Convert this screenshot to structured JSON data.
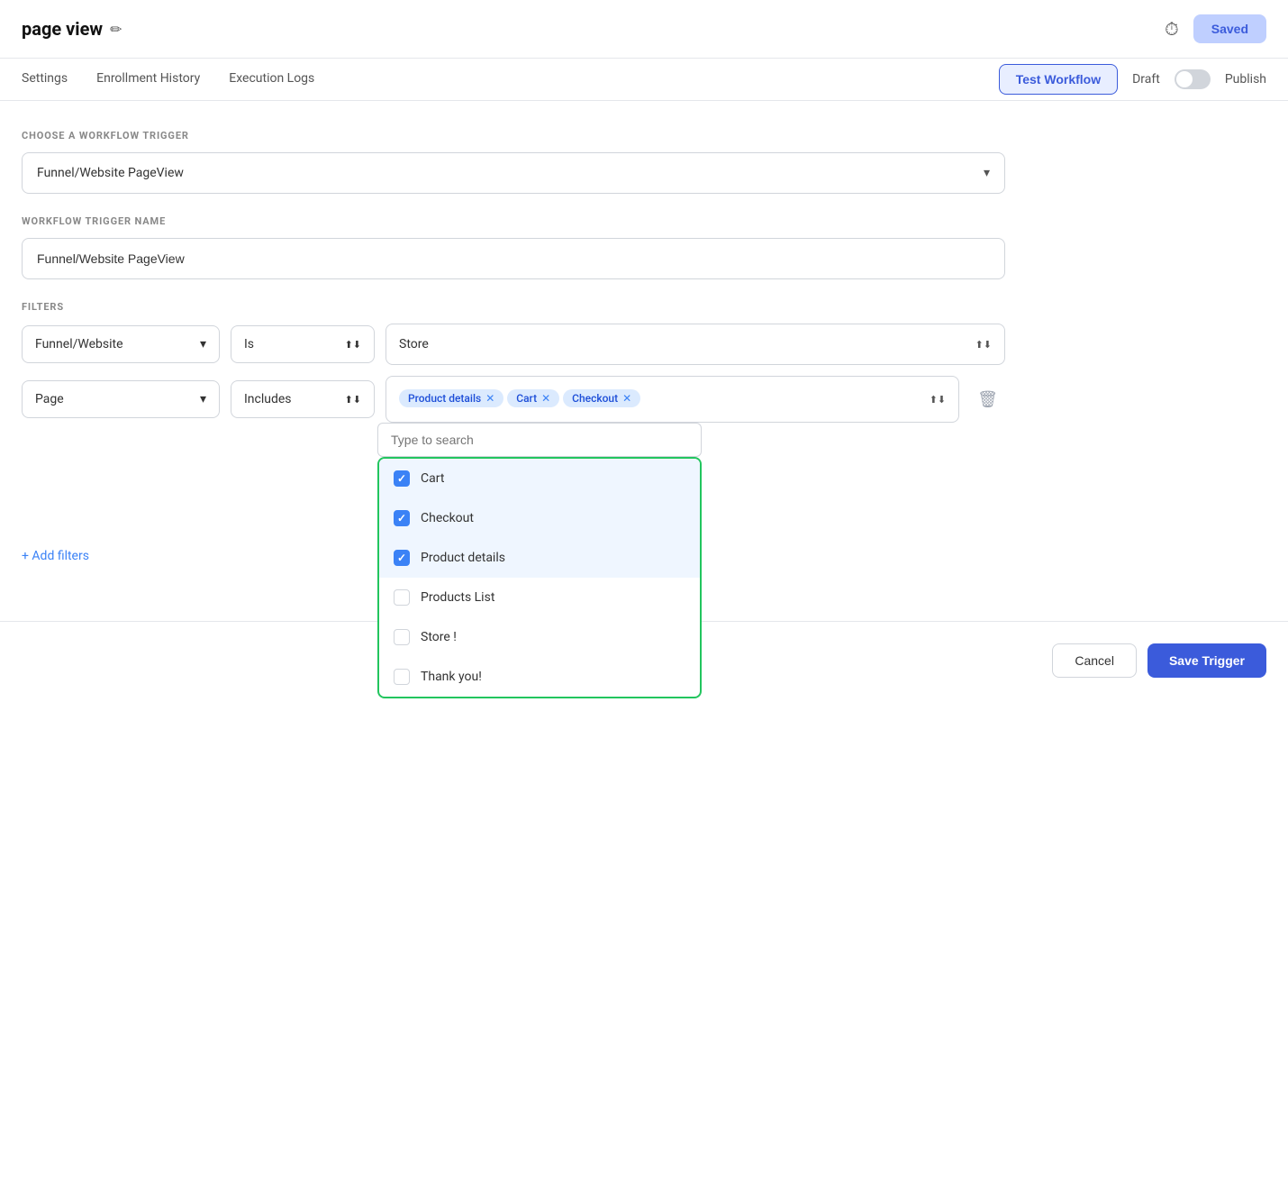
{
  "header": {
    "title": "page view",
    "edit_icon": "✏",
    "clock_icon": "🕐",
    "saved_label": "Saved"
  },
  "nav": {
    "tabs": [
      {
        "label": "Settings"
      },
      {
        "label": "Enrollment History"
      },
      {
        "label": "Execution Logs"
      }
    ],
    "test_workflow_label": "Test Workflow",
    "draft_label": "Draft",
    "publish_label": "Publish"
  },
  "form": {
    "trigger_section_label": "CHOOSE A WORKFLOW TRIGGER",
    "trigger_select_value": "Funnel/Website PageView",
    "trigger_name_label": "WORKFLOW TRIGGER NAME",
    "trigger_name_value": "Funnel/Website PageView",
    "filters_label": "FILTERS",
    "filter1": {
      "field": "Funnel/Website",
      "operator": "Is",
      "value": "Store"
    },
    "filter2": {
      "field": "Page",
      "operator": "Includes",
      "tags": [
        "Product details",
        "Cart",
        "Checkout"
      ]
    },
    "search_placeholder": "Type to search",
    "dropdown_items": [
      {
        "label": "Cart",
        "checked": true
      },
      {
        "label": "Checkout",
        "checked": true
      },
      {
        "label": "Product details",
        "checked": true
      },
      {
        "label": "Products List",
        "checked": false
      },
      {
        "label": "Store !",
        "checked": false
      },
      {
        "label": "Thank you!",
        "checked": false
      }
    ],
    "add_filters_label": "+ Add filters"
  },
  "footer": {
    "cancel_label": "Cancel",
    "save_label": "Save Trigger"
  },
  "colors": {
    "accent": "#3b5bdb",
    "tag_bg": "#dbeafe",
    "tag_text": "#1d4ed8",
    "checked_bg": "#3b82f6",
    "dropdown_border": "#22c55e",
    "selected_row_bg": "#eff6ff"
  }
}
